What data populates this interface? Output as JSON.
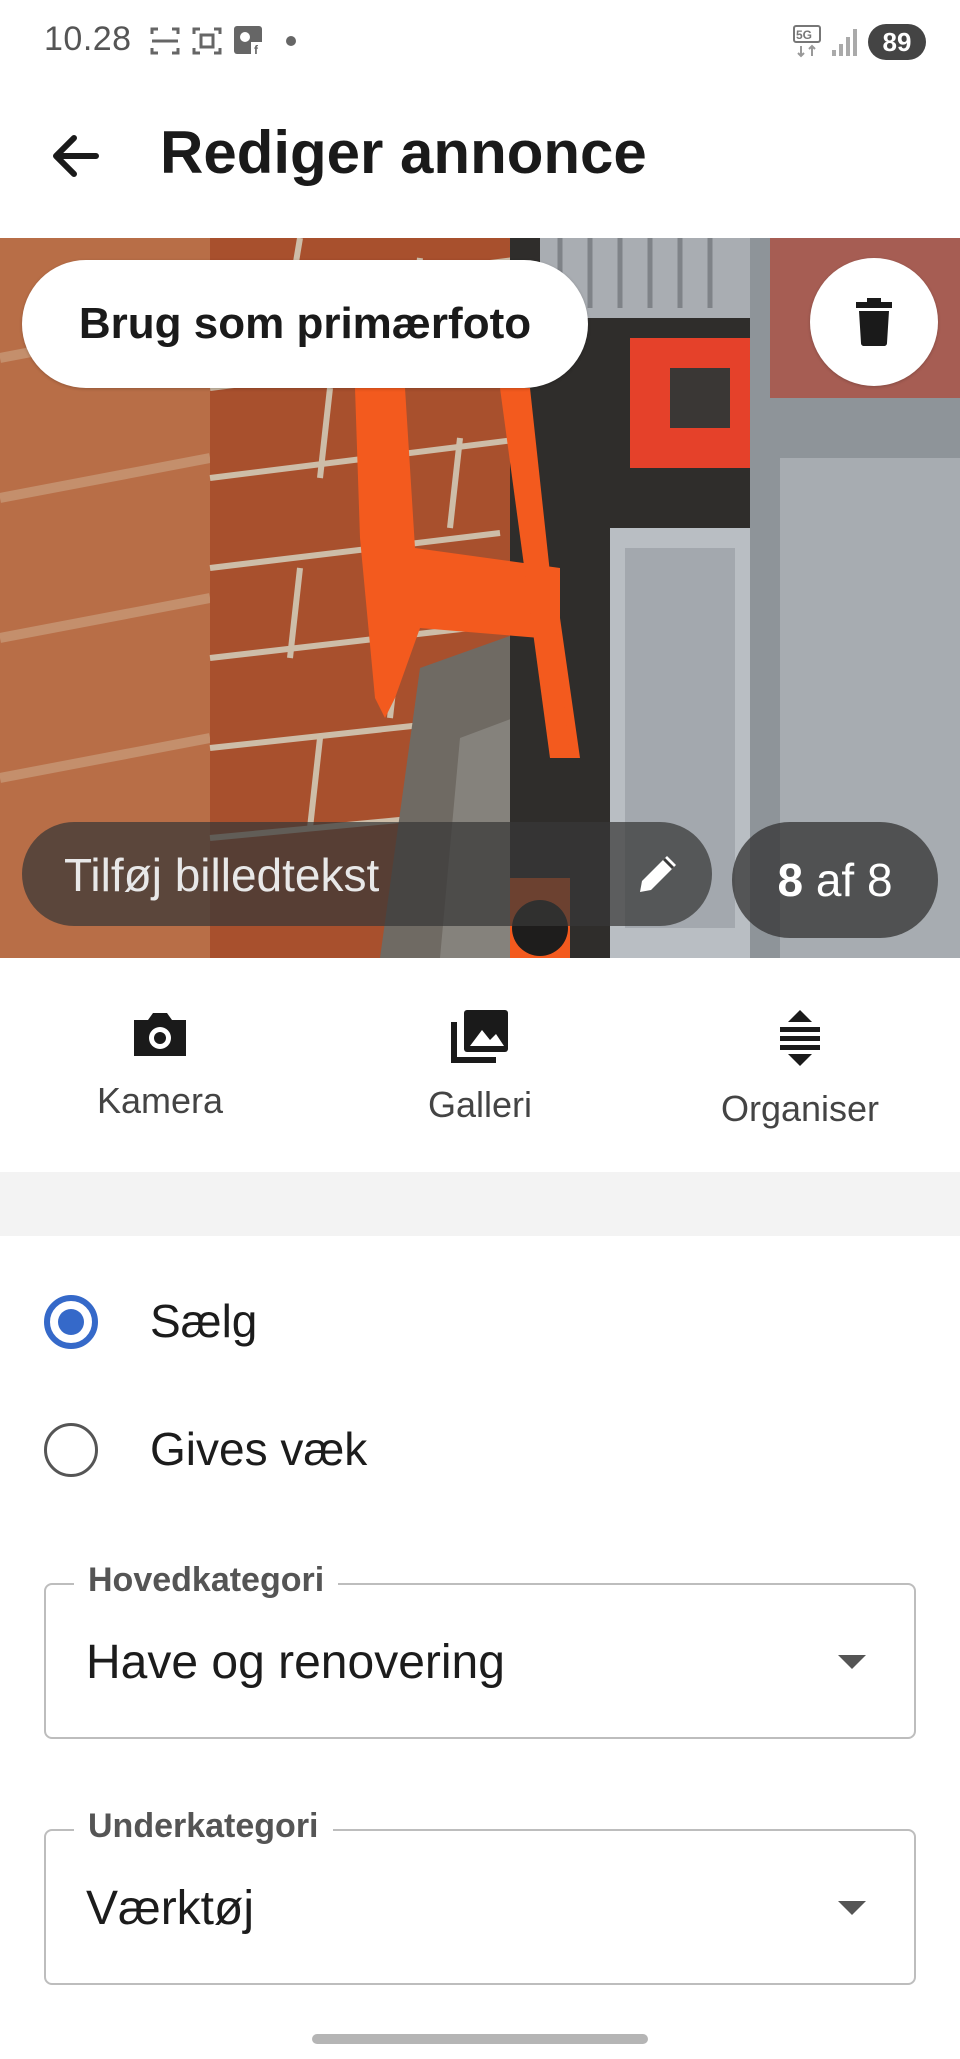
{
  "status_bar": {
    "time": "10.28",
    "network": "5G",
    "battery": "89"
  },
  "header": {
    "title": "Rediger annonce",
    "back_icon": "arrow-left-icon"
  },
  "photo": {
    "primary_label": "Brug som primærfoto",
    "delete_icon": "trash-icon",
    "caption_placeholder": "Tilføj billedtekst",
    "caption_icon": "pencil-icon",
    "counter_current": "8",
    "counter_text": "af 8"
  },
  "media_actions": [
    {
      "label": "Kamera",
      "icon": "camera-icon"
    },
    {
      "label": "Galleri",
      "icon": "gallery-icon"
    },
    {
      "label": "Organiser",
      "icon": "reorder-icon"
    }
  ],
  "listing_type": {
    "options": [
      {
        "label": "Sælg",
        "selected": true
      },
      {
        "label": "Gives væk",
        "selected": false
      }
    ]
  },
  "main_category": {
    "label": "Hovedkategori",
    "value": "Have og renovering"
  },
  "sub_category": {
    "label": "Underkategori",
    "value": "Værktøj"
  },
  "colors": {
    "accent": "#3569c9",
    "text": "#1c1c1c"
  }
}
